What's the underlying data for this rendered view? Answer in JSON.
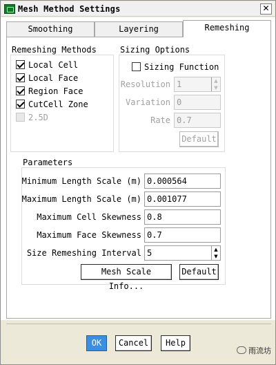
{
  "window": {
    "title": "Mesh Method Settings",
    "close_glyph": "✕",
    "icon": "app-mesh-icon"
  },
  "tabs": [
    {
      "label": "Smoothing",
      "active": false
    },
    {
      "label": "Layering",
      "active": false
    },
    {
      "label": "Remeshing",
      "active": true
    }
  ],
  "remeshing_methods": {
    "title": "Remeshing Methods",
    "items": [
      {
        "label": "Local Cell",
        "checked": true,
        "enabled": true
      },
      {
        "label": "Local Face",
        "checked": true,
        "enabled": true
      },
      {
        "label": "Region Face",
        "checked": true,
        "enabled": true
      },
      {
        "label": "CutCell Zone",
        "checked": true,
        "enabled": true
      },
      {
        "label": "2.5D",
        "checked": false,
        "enabled": false
      }
    ]
  },
  "sizing_options": {
    "title": "Sizing Options",
    "sizing_function": {
      "label": "Sizing Function",
      "checked": false
    },
    "resolution": {
      "label": "Resolution",
      "value": "1"
    },
    "variation": {
      "label": "Variation",
      "value": "0"
    },
    "rate": {
      "label": "Rate",
      "value": "0.7"
    },
    "default_label": "Default"
  },
  "parameters": {
    "title": "Parameters",
    "min_length": {
      "label": "Minimum Length Scale (m)",
      "value": "0.000564"
    },
    "max_length": {
      "label": "Maximum Length Scale (m)",
      "value": "0.001077"
    },
    "max_cell_skew": {
      "label": "Maximum Cell Skewness",
      "value": "0.8"
    },
    "max_face_skew": {
      "label": "Maximum Face Skewness",
      "value": "0.7"
    },
    "remesh_interval": {
      "label": "Size Remeshing Interval",
      "value": "5"
    },
    "mesh_scale_info_label": "Mesh Scale Info...",
    "default_label": "Default"
  },
  "footer": {
    "ok_label": "OK",
    "cancel_label": "Cancel",
    "help_label": "Help"
  },
  "watermark": {
    "text": "雨流坊",
    "icon": "wechat-icon"
  },
  "colors": {
    "ok_button": "#3c8fe0",
    "title_icon": "#0d7a28"
  }
}
